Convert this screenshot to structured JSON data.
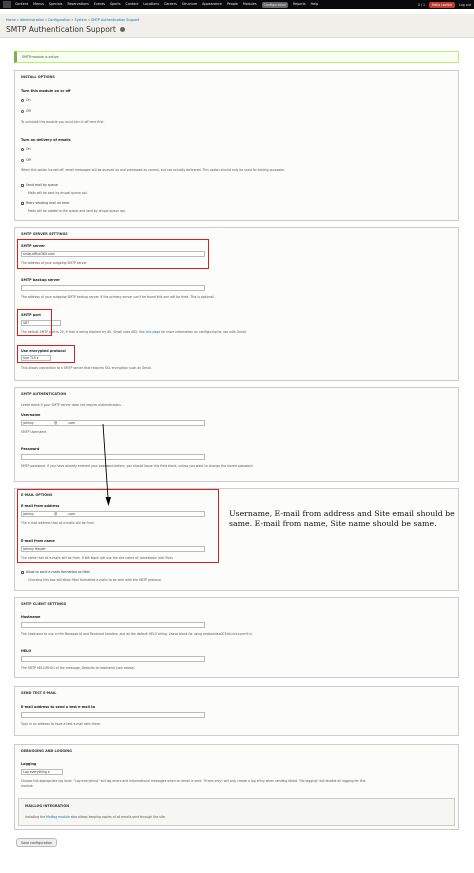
{
  "toolbar": {
    "items": [
      "Content",
      "Menus",
      "Specials",
      "Reservations",
      "Events",
      "Sports",
      "Contact",
      "Locations",
      "Careers",
      "Structure",
      "Appearance",
      "People",
      "Modules",
      "Configuration",
      "Reports",
      "Help"
    ],
    "shortcut_count": "0 / 1",
    "hello": "Hello cavlick",
    "logout": "Log out"
  },
  "breadcrumb": [
    "Home",
    "Administration",
    "Configuration",
    "System",
    "SMTP Authentication Support"
  ],
  "page_title": "SMTP Authentication Support",
  "status_message": "SMTP.module is active.",
  "install": {
    "legend": "INSTALL OPTIONS",
    "turn_on_label": "Turn this module on or off",
    "on": "On",
    "off": "Off",
    "turn_on_desc": "To uninstall this module you must turn it off here first.",
    "queue_label": "Turn on delivery of emails",
    "queue_desc": "When this option turned off, email messages will be queued up and processed as normal, but not actually delivered. This option should only be used for testing purposes.",
    "send_queue": "Send mail by queue",
    "send_queue_desc": "Mails will be sent by drupal queue api.",
    "retry": "Retry sending mail on error",
    "retry_desc": "Mails will be added to the queue and sent by drupal queue api."
  },
  "server": {
    "legend": "SMTP SERVER SETTINGS",
    "host_label": "SMTP server",
    "host_value": "smtp.office365.com",
    "host_desc": "The address of your outgoing SMTP server.",
    "backup_label": "SMTP backup server",
    "backup_desc": "The address of your outgoing SMTP backup server. If the primary server can't be found this one will be tried. This is optional.",
    "port_label": "SMTP port",
    "port_value": "587",
    "port_desc_1": "The default SMTP port is 25, if that is being blocked try 80. Gmail uses 465. See",
    "port_desc_link": "this page",
    "port_desc_2": "for more information on configuring for use with Gmail.",
    "enc_label": "Use encrypted protocol",
    "enc_value": "Use TLS",
    "enc_desc": "This allows connection to a SMTP server that requires SSL encryption such as Gmail."
  },
  "auth": {
    "legend": "SMTP AUTHENTICATION",
    "intro": "Leave blank if your SMTP server does not require authentication.",
    "user_label": "Username",
    "user_value": "johnny                    @          .com",
    "user_desc": "SMTP Username.",
    "pass_label": "Password",
    "pass_desc": "SMTP password. If you have already entered your password before, you should leave this field blank, unless you want to change the stored password."
  },
  "email": {
    "legend": "E-MAIL OPTIONS",
    "from_label": "E-mail from address",
    "from_value": "johnny                    @          .com",
    "from_desc": "The e-mail address that all e-mails will be from.",
    "name_label": "E-mail from name",
    "name_value": "Johnny Harper",
    "name_desc": "The name that all e-mails will be from. If left blank will use the site name of: Jamestown Irish Pubs",
    "html_label": "Allow to send e-mails formatted as Html",
    "html_desc": "Checking this box will allow Html formatted e-mails to be sent with the SMTP protocol."
  },
  "annotation": "Username, E-mail from address and Site email should be same. E-mail from name, Site name should be same.",
  "client": {
    "legend": "SMTP CLIENT SETTINGS",
    "host_label": "Hostname",
    "host_desc": "The hostname to use in the Message-Id and Received headers, and as the default HELO string. Leave blank for using endpointea007dd.chicx.perth.ir.",
    "helo_label": "HELO",
    "helo_desc": "The SMTP HELO/EHLO of the message. Defaults to hostname (see above)."
  },
  "test": {
    "legend": "SEND TEST E-MAIL",
    "label": "E-mail address to send a test e-mail to",
    "desc": "Type in an address to have a test e-mail sent there."
  },
  "debug": {
    "legend": "DEBUGGING AND LOGGING",
    "log_label": "Logging",
    "log_value": "Log everything",
    "log_desc_1": "Choose the appropriate log level. \"Log everything\" will log errors and informational messages when an email is sent. \"Errors only\" will only create a log entry when sending failed. \"No logging\" will disable all logging for this",
    "log_desc_2": "module.",
    "mailog_legend": "MAILLOG INTEGRATION",
    "mailog_1": "Installing the",
    "mailog_link": "Maillog module",
    "mailog_2": "also allows keeping copies of all emails sent through the site."
  },
  "save_button": "Save configuration",
  "colors": {
    "highlight": "#d82020",
    "link": "#0074bd",
    "status_green": "#77b259"
  }
}
